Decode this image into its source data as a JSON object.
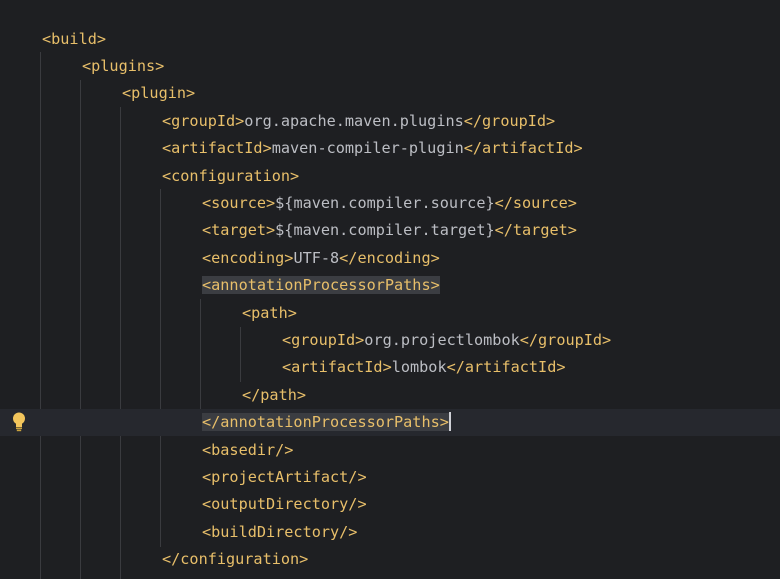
{
  "lines": [
    {
      "indent": 0,
      "parts": [
        {
          "c": "tag",
          "t": "<build>"
        }
      ]
    },
    {
      "indent": 1,
      "parts": [
        {
          "c": "tag",
          "t": "<plugins>"
        }
      ]
    },
    {
      "indent": 2,
      "parts": [
        {
          "c": "tag",
          "t": "<plugin>"
        }
      ]
    },
    {
      "indent": 3,
      "parts": [
        {
          "c": "tag",
          "t": "<groupId>"
        },
        {
          "c": "txt",
          "t": "org.apache.maven.plugins"
        },
        {
          "c": "tag",
          "t": "</groupId>"
        }
      ]
    },
    {
      "indent": 3,
      "parts": [
        {
          "c": "tag",
          "t": "<artifactId>"
        },
        {
          "c": "txt",
          "t": "maven-compiler-plugin"
        },
        {
          "c": "tag",
          "t": "</artifactId>"
        }
      ]
    },
    {
      "indent": 3,
      "parts": [
        {
          "c": "tag",
          "t": "<configuration>"
        }
      ]
    },
    {
      "indent": 4,
      "parts": [
        {
          "c": "tag",
          "t": "<source>"
        },
        {
          "c": "txt",
          "t": "${maven.compiler.source}"
        },
        {
          "c": "tag",
          "t": "</source>"
        }
      ]
    },
    {
      "indent": 4,
      "parts": [
        {
          "c": "tag",
          "t": "<target>"
        },
        {
          "c": "txt",
          "t": "${maven.compiler.target}"
        },
        {
          "c": "tag",
          "t": "</target>"
        }
      ]
    },
    {
      "indent": 4,
      "parts": [
        {
          "c": "tag",
          "t": "<encoding>"
        },
        {
          "c": "txt",
          "t": "UTF-8"
        },
        {
          "c": "tag",
          "t": "</encoding>"
        }
      ]
    },
    {
      "indent": 4,
      "parts": [
        {
          "c": "tag hl",
          "t": "<annotationProcessorPaths>"
        }
      ]
    },
    {
      "indent": 5,
      "parts": [
        {
          "c": "tag",
          "t": "<path>"
        }
      ]
    },
    {
      "indent": 6,
      "parts": [
        {
          "c": "tag",
          "t": "<groupId>"
        },
        {
          "c": "txt",
          "t": "org.projectlombok"
        },
        {
          "c": "tag",
          "t": "</groupId>"
        }
      ]
    },
    {
      "indent": 6,
      "parts": [
        {
          "c": "tag",
          "t": "<artifactId>"
        },
        {
          "c": "txt",
          "t": "lombok"
        },
        {
          "c": "tag",
          "t": "</artifactId>"
        }
      ]
    },
    {
      "indent": 5,
      "parts": [
        {
          "c": "tag",
          "t": "</path>"
        }
      ]
    },
    {
      "indent": 4,
      "current": true,
      "caret": true,
      "parts": [
        {
          "c": "tag hl",
          "t": "</annotationProcessorPaths>"
        }
      ]
    },
    {
      "indent": 4,
      "parts": [
        {
          "c": "tag",
          "t": "<basedir/>"
        }
      ]
    },
    {
      "indent": 4,
      "parts": [
        {
          "c": "tag",
          "t": "<projectArtifact/>"
        }
      ]
    },
    {
      "indent": 4,
      "parts": [
        {
          "c": "tag",
          "t": "<outputDirectory/>"
        }
      ]
    },
    {
      "indent": 4,
      "parts": [
        {
          "c": "tag",
          "t": "<buildDirectory/>"
        }
      ]
    },
    {
      "indent": 3,
      "parts": [
        {
          "c": "tag",
          "t": "</configuration>"
        }
      ]
    }
  ],
  "gutter": {
    "intention_icon": "lightbulb-icon",
    "icon_color": "#f2c55c"
  },
  "colors": {
    "background": "#1e1f22",
    "tag": "#e8bf6a",
    "text": "#bcbec4",
    "current_line": "#26282e",
    "brace_highlight": "#3b3d42"
  }
}
